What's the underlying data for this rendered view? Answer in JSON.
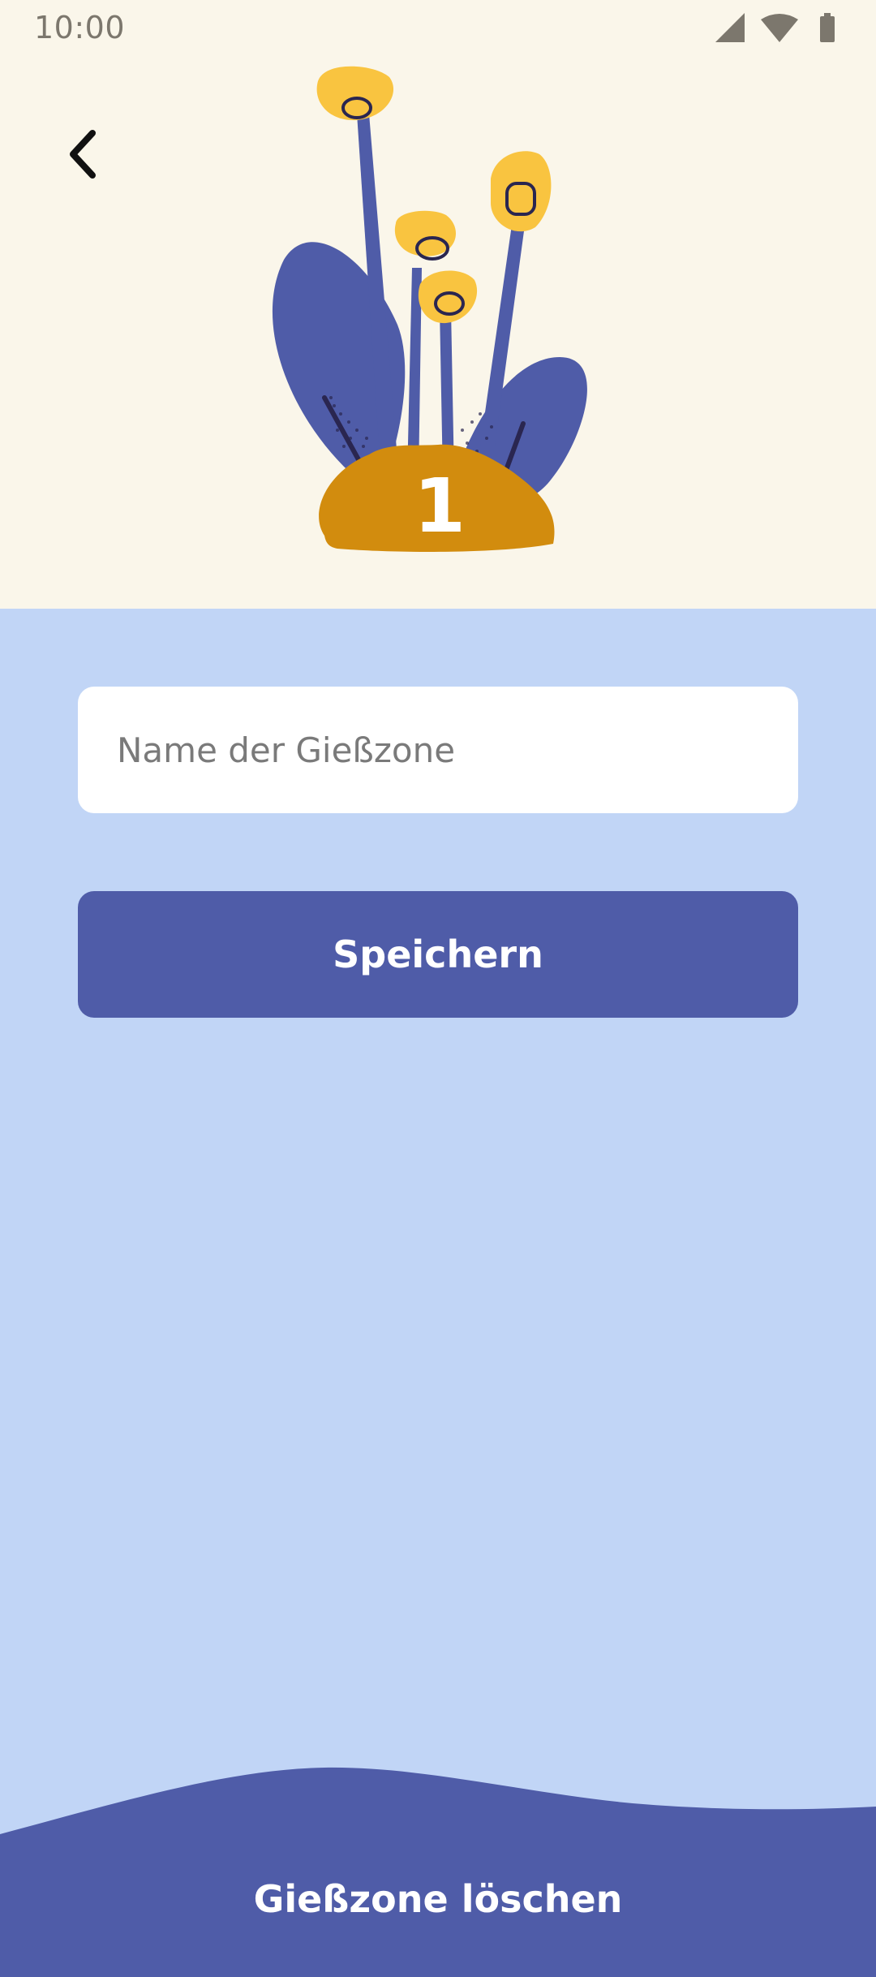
{
  "status_bar": {
    "time": "10:00",
    "icons": [
      "cellular-signal-icon",
      "wifi-icon",
      "battery-icon"
    ]
  },
  "navigation": {
    "back_icon": "chevron-left-icon"
  },
  "illustration": {
    "zone_number": "1",
    "colors": {
      "leaves": "#4F5CA8",
      "flowers": "#F9C440",
      "mound": "#D28C0E",
      "outline": "#2A2650"
    }
  },
  "form": {
    "name_input": {
      "value": "",
      "placeholder": "Name der Gießzone"
    },
    "save_label": "Speichern"
  },
  "footer": {
    "delete_label": "Gießzone löschen"
  },
  "colors": {
    "header_background": "#FAF6EA",
    "body_background": "#C1D5F6",
    "primary": "#4F5CA8",
    "input_background": "#FFFFFF"
  }
}
